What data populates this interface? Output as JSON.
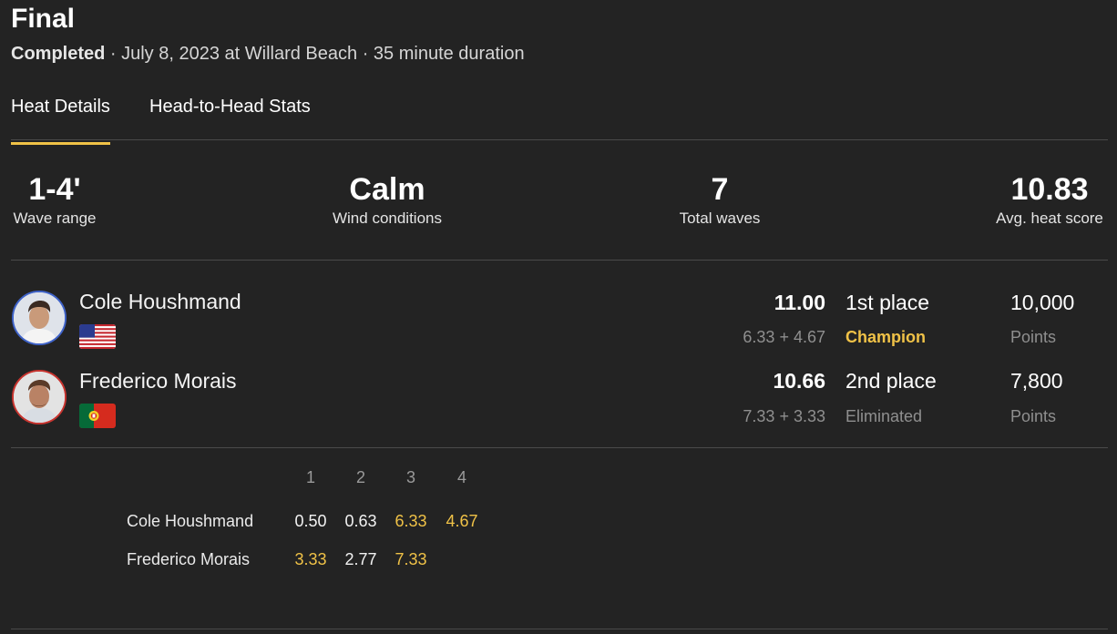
{
  "header": {
    "title": "Final",
    "status": "Completed",
    "details": " · July 8, 2023 at Willard Beach · 35 minute duration"
  },
  "tabs": [
    {
      "label": "Heat Details",
      "active": true
    },
    {
      "label": "Head-to-Head Stats",
      "active": false
    }
  ],
  "stats": [
    {
      "value": "1-4'",
      "label": "Wave range"
    },
    {
      "value": "Calm",
      "label": "Wind conditions"
    },
    {
      "value": "7",
      "label": "Total waves"
    },
    {
      "value": "10.83",
      "label": "Avg. heat score"
    }
  ],
  "athletes": [
    {
      "name": "Cole Houshmand",
      "flag_icon": "usa-flag-icon",
      "ring_color": "#3f63c9",
      "score": "11.00",
      "breakdown": "6.33 + 4.67",
      "place": "1st place",
      "result": "Champion",
      "points": "10,000",
      "points_label": "Points"
    },
    {
      "name": "Frederico Morais",
      "flag_icon": "portugal-flag-icon",
      "ring_color": "#c8342f",
      "score": "10.66",
      "breakdown": "7.33 + 3.33",
      "place": "2nd place",
      "result": "Eliminated",
      "points": "7,800",
      "points_label": "Points"
    }
  ],
  "wave_table": {
    "headers": [
      "1",
      "2",
      "3",
      "4"
    ],
    "rows": [
      {
        "name": "Cole Houshmand",
        "scores": [
          "0.50",
          "0.63",
          "6.33",
          "4.67"
        ],
        "counting": [
          false,
          false,
          true,
          true
        ]
      },
      {
        "name": "Frederico Morais",
        "scores": [
          "3.33",
          "2.77",
          "7.33"
        ],
        "counting": [
          true,
          false,
          true
        ]
      }
    ]
  },
  "colors": {
    "background": "#232323",
    "accent": "#f0c247",
    "muted": "#8f8f8f"
  }
}
